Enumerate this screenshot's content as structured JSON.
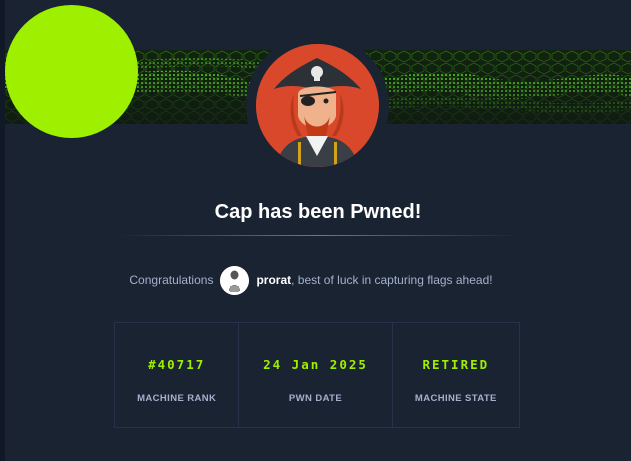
{
  "modal": {
    "title": "Cap has been Pwned!",
    "congrats_prefix": "Congratulations",
    "username": "prorat",
    "congrats_suffix": ", best of luck in capturing flags ahead!"
  },
  "stats": [
    {
      "value": "#40717",
      "label": "MACHINE RANK"
    },
    {
      "value": "24 Jan 2025",
      "label": "PWN DATE"
    },
    {
      "value": "RETIRED",
      "label": "MACHINE STATE"
    }
  ],
  "colors": {
    "background": "#1a2332",
    "accent": "#9fef00",
    "muted": "#a4b1cd"
  }
}
